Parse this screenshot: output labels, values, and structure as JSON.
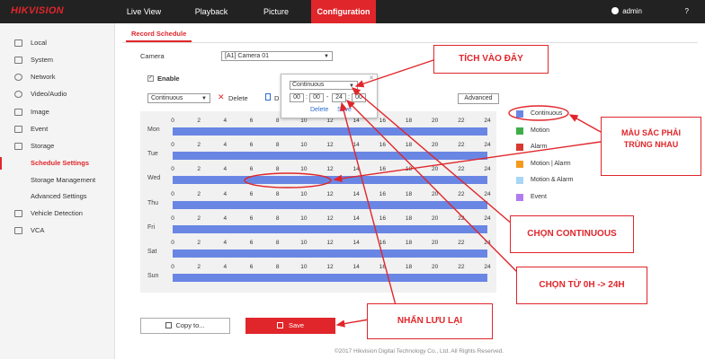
{
  "topbar": {
    "logo": "HIKVISION",
    "tabs": [
      "Live View",
      "Playback",
      "Picture",
      "Configuration"
    ],
    "user": "admin"
  },
  "sidebar": {
    "items": [
      {
        "label": "Local",
        "icon": "monitor-icon"
      },
      {
        "label": "System",
        "icon": "system-icon"
      },
      {
        "label": "Network",
        "icon": "globe-icon"
      },
      {
        "label": "Video/Audio",
        "icon": "video-icon"
      },
      {
        "label": "Image",
        "icon": "image-icon"
      },
      {
        "label": "Event",
        "icon": "calendar-icon"
      },
      {
        "label": "Storage",
        "icon": "storage-icon"
      },
      {
        "label": "Schedule Settings",
        "icon": ""
      },
      {
        "label": "Storage Management",
        "icon": ""
      },
      {
        "label": "Advanced Settings",
        "icon": ""
      },
      {
        "label": "Vehicle Detection",
        "icon": "car-icon"
      },
      {
        "label": "VCA",
        "icon": "vca-icon"
      }
    ],
    "active": "Schedule Settings"
  },
  "main": {
    "tab": "Record Schedule",
    "camera_label": "Camera",
    "camera_value": "[A1] Camera 01",
    "enable_label": "Enable",
    "type_value": "Continuous",
    "delete_label": "Delete",
    "delete_all_label": "D",
    "advanced_label": "Advanced"
  },
  "popup": {
    "type_value": "Continuous",
    "start_h": "00",
    "start_m": "00",
    "end_h": "24",
    "end_m": "00",
    "delete_label": "Delete",
    "save_label": "Save"
  },
  "schedule": {
    "days": [
      "Mon",
      "Tue",
      "Wed",
      "Thu",
      "Fri",
      "Sat",
      "Sun"
    ],
    "ticks": [
      "0",
      "2",
      "4",
      "6",
      "8",
      "10",
      "12",
      "14",
      "16",
      "18",
      "20",
      "22",
      "24"
    ],
    "bar_color": "#6a86e4",
    "coverage_hours": [
      24,
      24,
      24,
      24,
      24,
      24,
      24
    ]
  },
  "legend": [
    {
      "label": "Continuous",
      "color": "#6a86e4"
    },
    {
      "label": "Motion",
      "color": "#3fae49"
    },
    {
      "label": "Alarm",
      "color": "#d83a32"
    },
    {
      "label": "Motion | Alarm",
      "color": "#f59a1c"
    },
    {
      "label": "Motion & Alarm",
      "color": "#a9d6f5"
    },
    {
      "label": "Event",
      "color": "#b07cf2"
    }
  ],
  "buttons": {
    "copy": "Copy to...",
    "save": "Save"
  },
  "footer": "©2017 Hikvision Digital Technology Co., Ltd. All Rights Reserved.",
  "annotations": {
    "tick": "TÍCH VÀO ĐÂY",
    "color_line1": "MÀU SẮC PHẢI",
    "color_line2": "TRÙNG NHAU",
    "continuous": "CHỌN CONTINUOUS",
    "time": "CHỌN TỪ 0H -> 24H",
    "save": "NHẤN LƯU LẠI"
  }
}
